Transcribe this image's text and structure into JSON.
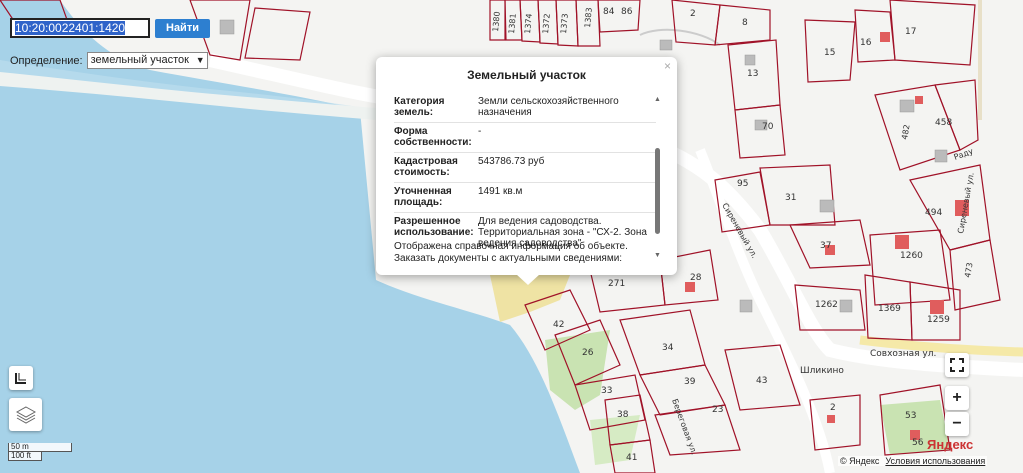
{
  "search": {
    "value": "10:20:0022401:1420",
    "button": "Найти"
  },
  "definition": {
    "label": "Определение:",
    "selected": "земельный участок"
  },
  "popup": {
    "title": "Земельный участок",
    "close": "×",
    "rows": [
      {
        "key": "Категория земель:",
        "value": "Земли сельскохозяйственного назначения"
      },
      {
        "key": "Форма собственности:",
        "value": "-"
      },
      {
        "key": "Кадастровая стоимость:",
        "value": "543786.73 руб"
      },
      {
        "key": "Уточненная площадь:",
        "value": "1491 кв.м"
      },
      {
        "key": "Разрешенное использование:",
        "value": "Для ведения садоводства. Территориальная зона - \"СХ-2. Зона ведения садоводства\""
      }
    ],
    "note": "Отображена справочная информация об объекте. Заказать документы с актуальными сведениями:"
  },
  "map": {
    "plot_numbers": [
      "1380",
      "1381",
      "1374",
      "1372",
      "1373",
      "1383",
      "84",
      "86",
      "2",
      "8",
      "15",
      "16",
      "17",
      "13",
      "70",
      "482",
      "458",
      "494",
      "1260",
      "473",
      "95",
      "31",
      "37",
      "1262",
      "1369",
      "1259",
      "28",
      "271",
      "42",
      "26",
      "34",
      "33",
      "39",
      "43",
      "38",
      "23",
      "41",
      "53",
      "56",
      "2"
    ],
    "street_labels": [
      "Сиреневый ул.",
      "Совхозная ул.",
      "Береговая ул.",
      "Раду"
    ],
    "place_label": "Шликино"
  },
  "controls": {
    "zoom_in": "+",
    "zoom_out": "−",
    "fullscreen_icon": "fullscreen-icon",
    "ruler_icon": "ruler-icon",
    "layers_icon": "layers-icon"
  },
  "scale": {
    "meters": "50 m",
    "feet": "100 ft"
  },
  "attribution": {
    "logo": "Яндекс",
    "copyright": "© Яндекс",
    "terms": "Условия использования"
  },
  "colors": {
    "water": "#a6d2e8",
    "land": "#f4f4f2",
    "plot_border": "#a01228",
    "button": "#2d7fd0",
    "sand": "#efe3a4",
    "green": "#c9e3b2"
  }
}
